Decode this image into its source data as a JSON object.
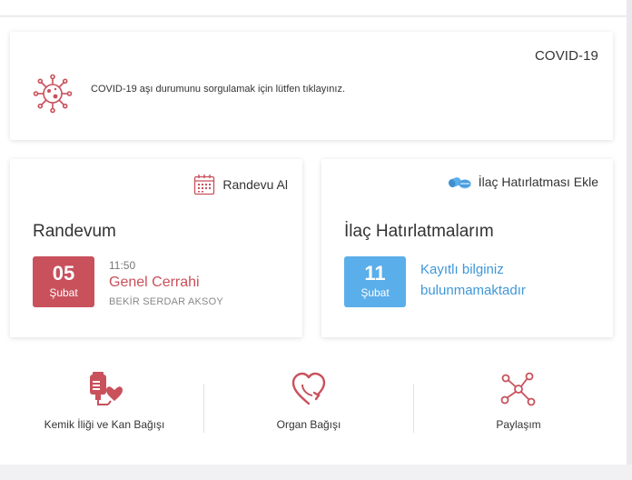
{
  "covid": {
    "title": "COVID-19",
    "text": "COVID-19 aşı durumunu sorgulamak için lütfen tıklayınız.",
    "icon": "virus-icon"
  },
  "appointment": {
    "action_label": "Randevu Al",
    "action_icon": "calendar-icon",
    "heading": "Randevum",
    "day": "05",
    "month": "Şubat",
    "time": "11:50",
    "department": "Genel Cerrahi",
    "doctor": "BEKİR SERDAR AKSOY"
  },
  "medication": {
    "action_label": "İlaç Hatırlatması Ekle",
    "action_icon": "pill-icon",
    "heading": "İlaç Hatırlatmalarım",
    "day": "11",
    "month": "Şubat",
    "empty_message": "Kayıtlı bilginiz bulunmamaktadır"
  },
  "links": [
    {
      "label": "Kemik İliği ve Kan Bağışı",
      "icon": "blood-donation-icon"
    },
    {
      "label": "Organ Bağışı",
      "icon": "organ-donation-heart-icon"
    },
    {
      "label": "Paylaşım",
      "icon": "share-network-icon"
    }
  ],
  "colors": {
    "accent_red": "#c8515c",
    "accent_blue": "#5aaeea",
    "link_blue": "#3f97d8"
  }
}
